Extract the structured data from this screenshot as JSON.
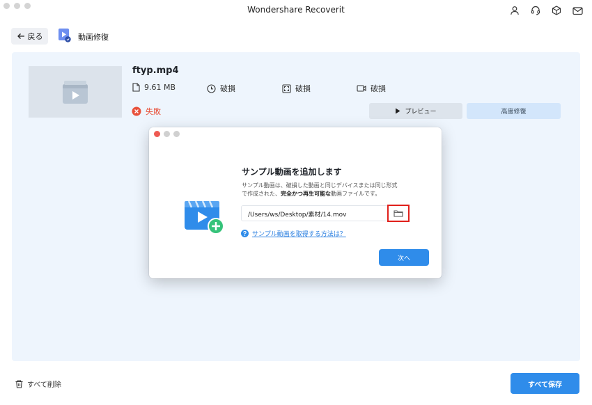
{
  "window": {
    "title": "Wondershare Recoverit"
  },
  "toolbar": {
    "icons": [
      "user-icon",
      "headset-icon",
      "box-icon",
      "mail-icon"
    ]
  },
  "header": {
    "back_label": "戻る",
    "page_title": "動画修復"
  },
  "file": {
    "name": "ftyp.mp4",
    "size": "9.61 MB",
    "duration_status": "破損",
    "resolution_status": "破損",
    "video_status": "破損",
    "repair_status": "失敗",
    "preview_label": "プレビュー",
    "advanced_label": "高度修復"
  },
  "dialog": {
    "title": "サンプル動画を追加します",
    "description_line1": "サンプル動画は、破損した動画と同じデバイスまたは同じ形式",
    "description_line2_prefix": "で作成された、",
    "description_line2_bold": "完全かつ再生可能な",
    "description_line2_suffix": "動画ファイルです。",
    "path_value": "/Users/ws/Desktop/素材/14.mov",
    "help_link": "サンプル動画を取得する方法は？",
    "next_label": "次へ"
  },
  "footer": {
    "delete_all_label": "すべて削除",
    "save_all_label": "すべて保存"
  },
  "colors": {
    "accent": "#2f8cea",
    "panel_bg": "#eef5fd",
    "error": "#e8503a",
    "highlight_border": "#e0201b"
  }
}
